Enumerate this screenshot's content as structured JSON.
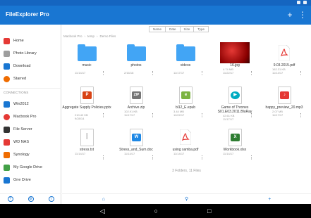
{
  "app": {
    "title": "FileExplorer Pro"
  },
  "sidebar": {
    "items": [
      {
        "label": "Home",
        "color": "#e53935",
        "icon": "home-icon"
      },
      {
        "label": "Photo Library",
        "color": "#8e8e8e",
        "icon": "photo-library-icon"
      },
      {
        "label": "Download",
        "color": "#1976d2",
        "icon": "download-icon"
      },
      {
        "label": "Starred",
        "color": "#ef6c00",
        "icon": "star-icon"
      }
    ],
    "connections_header": "CONNECTIONS",
    "connections": [
      {
        "label": "Win2012",
        "color": "#1976d2",
        "icon": "windows-server-icon"
      },
      {
        "label": "Macbook Pro",
        "color": "#e53935",
        "icon": "macbook-icon"
      },
      {
        "label": "File Server",
        "color": "#333333",
        "icon": "file-server-icon"
      },
      {
        "label": "WD NAS",
        "color": "#e53935",
        "icon": "nas-icon"
      },
      {
        "label": "Synology",
        "color": "#ef6c00",
        "icon": "synology-icon"
      },
      {
        "label": "My Google Drive",
        "color": "#43a047",
        "icon": "google-drive-icon"
      },
      {
        "label": "One Drive",
        "color": "#1976d2",
        "icon": "onedrive-icon"
      }
    ]
  },
  "sort": {
    "name": "Name",
    "date": "Date",
    "size": "Size",
    "type": "Type"
  },
  "breadcrumb": [
    "Macbook Pro",
    "temp",
    "Demo Files"
  ],
  "files": [
    {
      "name": "music",
      "kind": "folder",
      "meta": [
        "11/14/17"
      ]
    },
    {
      "name": "photos",
      "kind": "folder",
      "meta": [
        "2/16/18"
      ]
    },
    {
      "name": "videos",
      "kind": "folder",
      "meta": [
        "11/17/17"
      ]
    },
    {
      "name": "16.jpg",
      "kind": "image",
      "meta": [
        "4.74 MB",
        "11/22/17"
      ]
    },
    {
      "name": "9.03.2015.pdf",
      "kind": "pdf",
      "meta": [
        "162.31 KB",
        "11/14/17"
      ]
    },
    {
      "name": "Aggregate Supply Policies.pptx",
      "kind": "pptx",
      "meta": [
        "210.42 KB",
        "9/28/14"
      ]
    },
    {
      "name": "Archive.zip",
      "kind": "zip",
      "meta": [
        "102.91 KB",
        "11/17/17"
      ]
    },
    {
      "name": "bl12_E.epub",
      "kind": "epub",
      "meta": [
        "3.44 MB",
        "11/22/17"
      ]
    },
    {
      "name": "Game of Thrones S01.E03.2011.BluRay",
      "kind": "video",
      "meta": [
        "42.61 KB",
        "11/17/17"
      ]
    },
    {
      "name": "happy_preview_20.mp3",
      "kind": "mp3",
      "meta": [
        "2.07 MB",
        "11/17/17"
      ]
    },
    {
      "name": "stress.txt",
      "kind": "txt",
      "meta": [
        "11/14/17"
      ]
    },
    {
      "name": "Stress_and_Sum.doc",
      "kind": "doc",
      "meta": [
        "11/14/17"
      ]
    },
    {
      "name": "using samba.pdf",
      "kind": "pdf",
      "meta": [
        "11/14/17"
      ]
    },
    {
      "name": "Workbook.xlsx",
      "kind": "xlsx",
      "meta": [
        "11/14/17"
      ]
    }
  ],
  "summary": "3 Folders, 11 Files",
  "colors": {
    "accent": "#1976d2",
    "folder": "#42a5f5"
  }
}
